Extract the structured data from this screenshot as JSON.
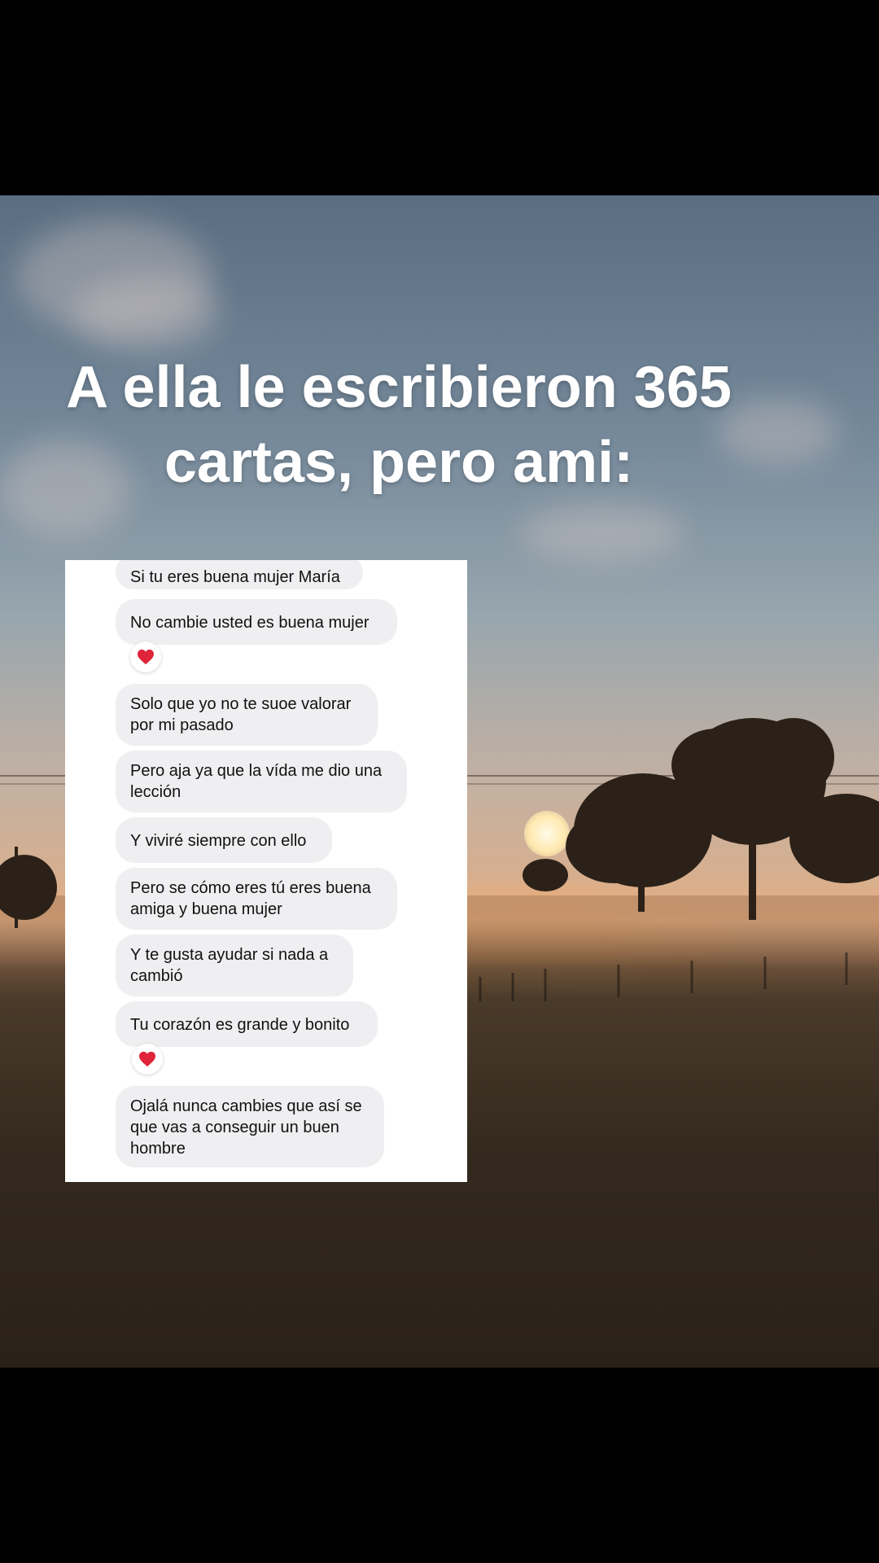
{
  "headline": {
    "line1": "A ella le escribieron 365",
    "line2": "cartas, pero ami:"
  },
  "messages": [
    "Si tu eres buena mujer María",
    "No cambie usted es buena mujer",
    "Solo que yo no te suoe valorar por mi pasado",
    "Pero aja ya que la vída me dio una lección",
    "Y viviré siempre con ello",
    "Pero se cómo eres tú eres buena amiga y buena mujer",
    "Y te gusta ayudar si nada a cambió",
    "Tu corazón es grande y bonito",
    "Ojalá nunca cambies que así se que vas a conseguir un buen hombre"
  ],
  "reaction_icon": "red-heart-icon",
  "colors": {
    "bubble": "#efeff1",
    "heart": "#e0243a",
    "headline_text": "#ffffff"
  }
}
